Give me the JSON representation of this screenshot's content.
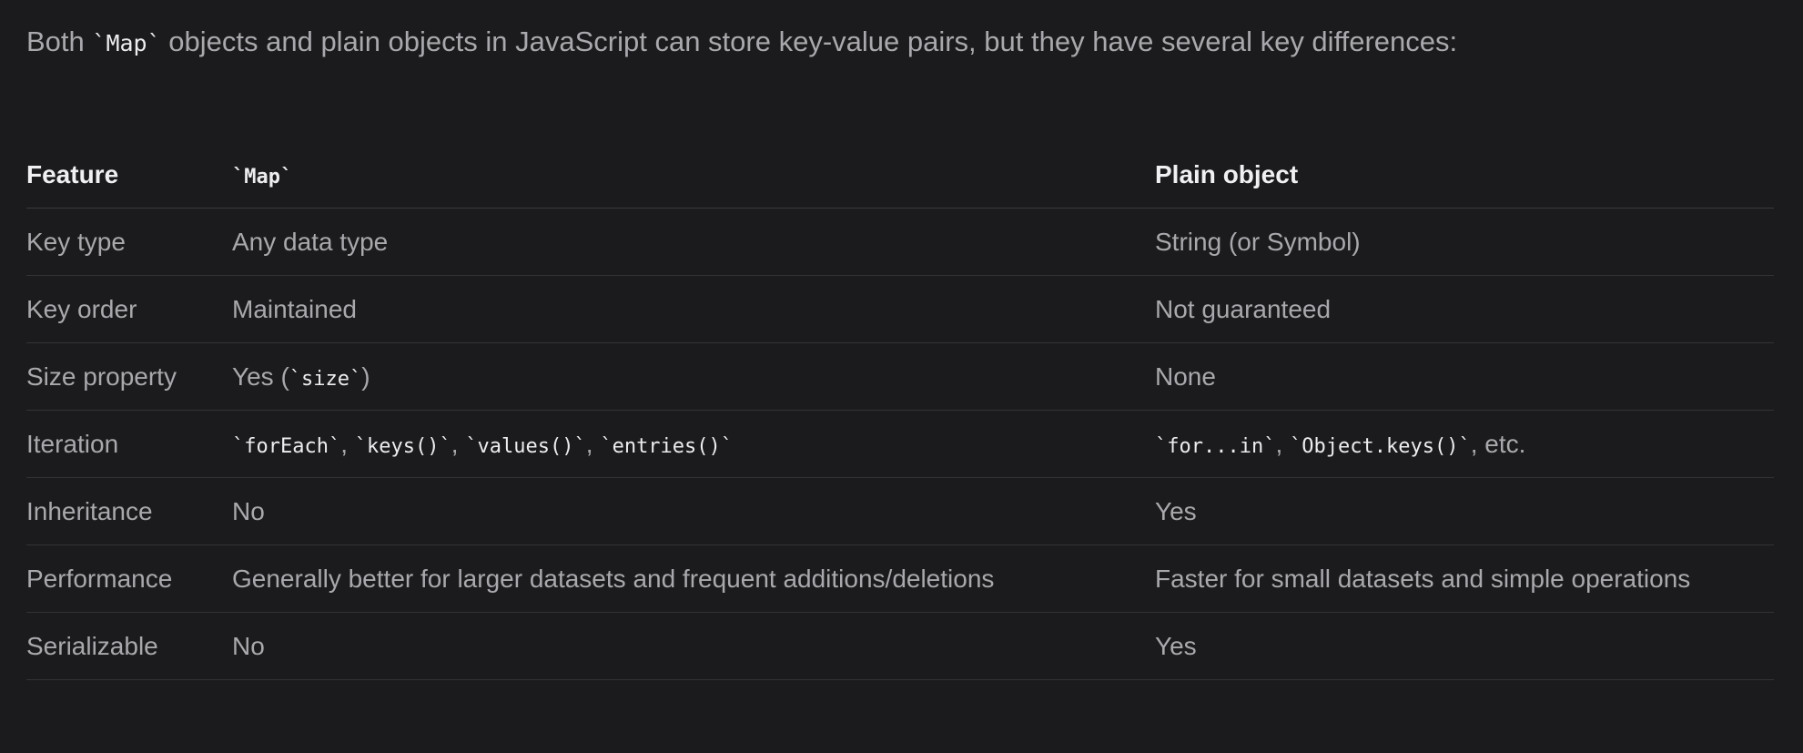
{
  "intro": {
    "before": "Both ",
    "code": "`Map`",
    "after": " objects and plain objects in JavaScript can store key-value pairs, but they have several key differences:"
  },
  "table": {
    "headers": {
      "feature": "Feature",
      "map": "`Map`",
      "object": "Plain object"
    },
    "rows": [
      {
        "feature": "Key type",
        "map": [
          {
            "text": "Any data type",
            "code": false
          }
        ],
        "object": [
          {
            "text": "String (or Symbol)",
            "code": false
          }
        ]
      },
      {
        "feature": "Key order",
        "map": [
          {
            "text": "Maintained",
            "code": false
          }
        ],
        "object": [
          {
            "text": "Not guaranteed",
            "code": false
          }
        ]
      },
      {
        "feature": "Size property",
        "map": [
          {
            "text": "Yes (",
            "code": false
          },
          {
            "text": "`size`",
            "code": true
          },
          {
            "text": ")",
            "code": false
          }
        ],
        "object": [
          {
            "text": "None",
            "code": false
          }
        ]
      },
      {
        "feature": "Iteration",
        "map": [
          {
            "text": "`forEach`",
            "code": true
          },
          {
            "text": ", ",
            "code": false
          },
          {
            "text": "`keys()`",
            "code": true
          },
          {
            "text": ", ",
            "code": false
          },
          {
            "text": "`values()`",
            "code": true
          },
          {
            "text": ", ",
            "code": false
          },
          {
            "text": "`entries()`",
            "code": true
          }
        ],
        "object": [
          {
            "text": "`for...in`",
            "code": true
          },
          {
            "text": ", ",
            "code": false
          },
          {
            "text": "`Object.keys()`",
            "code": true
          },
          {
            "text": ", etc.",
            "code": false
          }
        ]
      },
      {
        "feature": "Inheritance",
        "map": [
          {
            "text": "No",
            "code": false
          }
        ],
        "object": [
          {
            "text": "Yes",
            "code": false
          }
        ]
      },
      {
        "feature": "Performance",
        "map": [
          {
            "text": "Generally better for larger datasets and frequent additions/deletions",
            "code": false
          }
        ],
        "object": [
          {
            "text": "Faster for small datasets and simple operations",
            "code": false
          }
        ]
      },
      {
        "feature": "Serializable",
        "map": [
          {
            "text": "No",
            "code": false
          }
        ],
        "object": [
          {
            "text": "Yes",
            "code": false
          }
        ]
      }
    ]
  }
}
